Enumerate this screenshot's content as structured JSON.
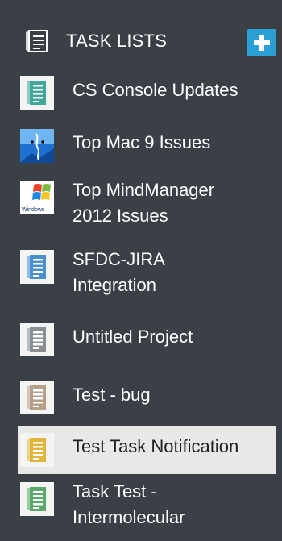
{
  "header": {
    "title": "TASK LISTS",
    "add_icon": "plus-icon",
    "list_icon": "task-list-icon"
  },
  "colors": {
    "background": "#3b4046",
    "accent": "#2a9fd6",
    "active_bg": "#e8e8e8",
    "teal": "#3fa89a",
    "blue": "#4a8fd0",
    "gray": "#8a8f95",
    "tan": "#b7a08a",
    "yellow": "#e0b53a",
    "green": "#5aa86a"
  },
  "items": [
    {
      "label_lines": [
        "CS Console Updates"
      ],
      "icon": "teal-list-icon"
    },
    {
      "label_lines": [
        "Top Mac 9 Issues"
      ],
      "icon": "mac-finder-icon"
    },
    {
      "label_lines": [
        "Top MindManager",
        "2012 Issues"
      ],
      "icon": "windows-logo-icon",
      "icon_text": "Windows"
    },
    {
      "label_lines": [
        "SFDC-JIRA",
        "Integration"
      ],
      "icon": "blue-list-icon"
    },
    {
      "label_lines": [
        "Untitled Project"
      ],
      "icon": "gray-list-icon"
    },
    {
      "label_lines": [
        "Test - bug"
      ],
      "icon": "tan-list-icon"
    },
    {
      "label_lines": [
        "Test Task Notification"
      ],
      "icon": "yellow-list-icon",
      "active": true
    },
    {
      "label_lines": [
        "Task Test -",
        "Intermolecular"
      ],
      "icon": "green-list-icon"
    }
  ]
}
